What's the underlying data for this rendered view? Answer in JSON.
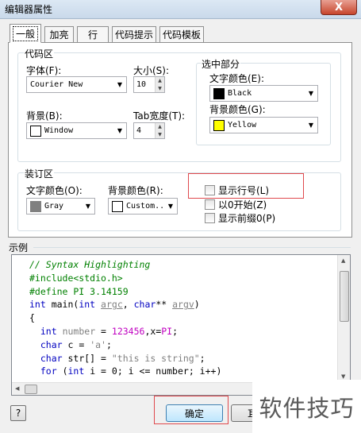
{
  "window": {
    "title": "编辑器属性",
    "close_label": "X"
  },
  "tabs": [
    "一般",
    "加亮",
    "行",
    "代码提示",
    "代码模板"
  ],
  "code_group": {
    "label": "代码区",
    "font_label": "字体(F):",
    "font_value": "Courier New",
    "size_label": "大小(S):",
    "size_value": "10",
    "bg_label": "背景(B):",
    "bg_value": "Window",
    "bg_swatch": "#ffffff",
    "tab_label": "Tab宽度(T):",
    "tab_value": "4"
  },
  "selection_group": {
    "label": "选中部分",
    "text_color_label": "文字颜色(E):",
    "text_color_value": "Black",
    "text_swatch": "#000000",
    "bg_color_label": "背景颜色(G):",
    "bg_color_value": "Yellow",
    "bg_swatch": "#ffff00"
  },
  "gutter_group": {
    "label": "装订区",
    "text_color_label": "文字颜色(O):",
    "text_color_value": "Gray",
    "text_swatch": "#808080",
    "bg_color_label": "背景颜色(R):",
    "bg_color_value": "Custom..",
    "bg_swatch": "#ffffff",
    "checkboxes": [
      "显示行号(L)",
      "以0开始(Z)",
      "显示前缀0(P)"
    ]
  },
  "sample": {
    "label": "示例",
    "lines": [
      "// Syntax Highlighting",
      "#include<stdio.h>",
      "#define PI 3.14159",
      "int main(int argc, char** argv)",
      "{",
      "  int number = 123456,x=PI;",
      "  char c = 'a';",
      "  char str[] = \"this is string\";",
      "  for (int i = 0; i <= number; i++)"
    ]
  },
  "buttons": {
    "help": "?",
    "ok": "确定",
    "cancel_partial": "耳"
  },
  "watermark": "软件技巧",
  "colors": {
    "highlight_box": "#e0494d",
    "keyword": "#0000c0",
    "comment": "#008000",
    "number": "#c000c0"
  }
}
